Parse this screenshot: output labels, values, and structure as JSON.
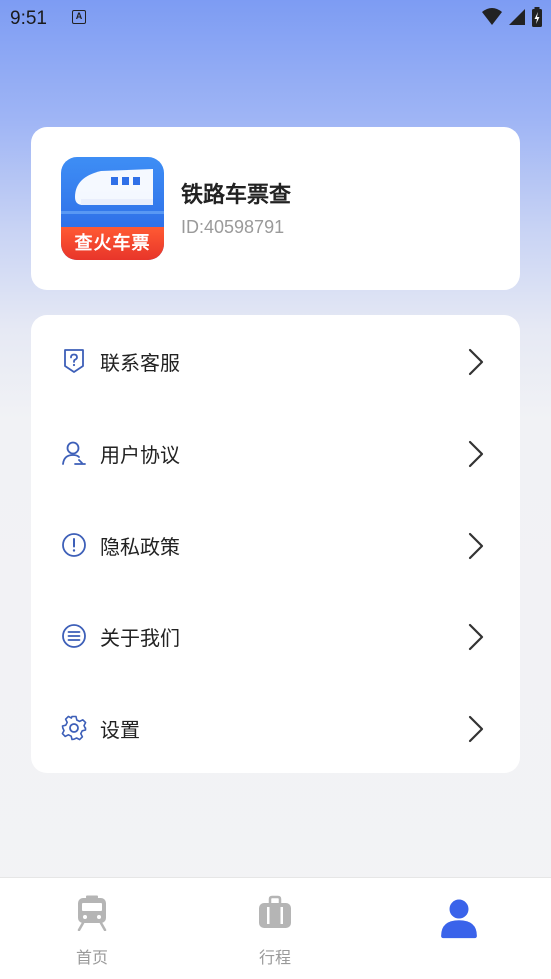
{
  "status_bar": {
    "time": "9:51",
    "notification_icon_letter": "A"
  },
  "profile": {
    "app_name": "铁路车票查",
    "user_id": "ID:40598791",
    "logo_banner_text": "查火车票"
  },
  "menu": {
    "items": [
      {
        "label": "联系客服",
        "icon": "shield-question-icon"
      },
      {
        "label": "用户协议",
        "icon": "user-agreement-icon"
      },
      {
        "label": "隐私政策",
        "icon": "exclamation-circle-icon"
      },
      {
        "label": "关于我们",
        "icon": "list-circle-icon"
      },
      {
        "label": "设置",
        "icon": "gear-icon"
      }
    ]
  },
  "bottom_nav": {
    "tabs": [
      {
        "label": "首页",
        "icon": "train-icon",
        "active": false
      },
      {
        "label": "行程",
        "icon": "suitcase-icon",
        "active": false
      },
      {
        "label": "",
        "icon": "profile-icon",
        "active": true
      }
    ]
  },
  "colors": {
    "accent": "#3a63ea",
    "icon_blue": "#3d5fb8",
    "inactive": "#b5b5b5"
  }
}
